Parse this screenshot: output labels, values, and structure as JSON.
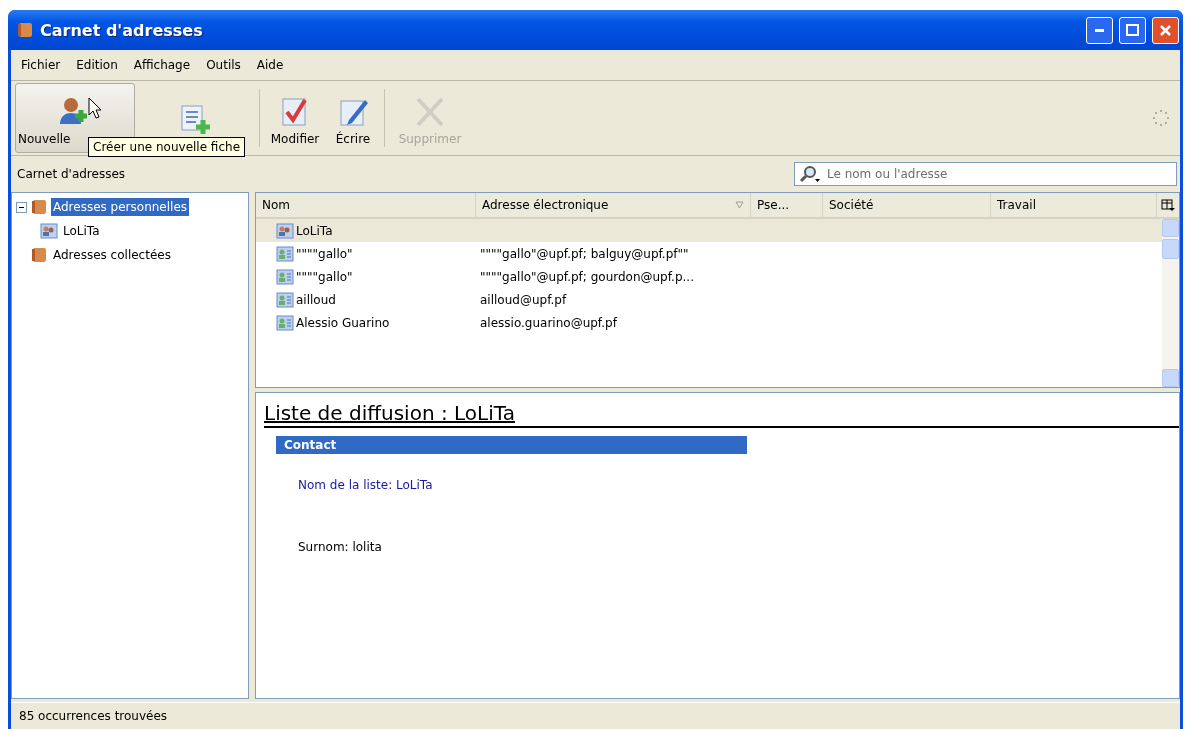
{
  "window": {
    "title": "Carnet d'adresses"
  },
  "menu": [
    "Fichier",
    "Edition",
    "Affichage",
    "Outils",
    "Aide"
  ],
  "toolbar": [
    {
      "kind": "new-card",
      "label": "Nouvelle",
      "disabled": false,
      "hovered": true
    },
    {
      "kind": "new-list",
      "disabled": false,
      "hovered": false
    },
    {
      "kind": "edit",
      "label": "Modifier",
      "disabled": false,
      "hovered": false
    },
    {
      "kind": "write",
      "label": "Écrire",
      "disabled": false,
      "hovered": false
    },
    {
      "kind": "delete",
      "label": "Supprimer",
      "disabled": true,
      "hovered": false
    }
  ],
  "tooltip": "Créer une nouvelle fiche",
  "address_bar": {
    "title": "Carnet d'adresses",
    "search": {
      "placeholder": "Le nom ou l'adresse"
    }
  },
  "sidebar": {
    "items": [
      {
        "label": "Adresses personnelles",
        "selected": true,
        "expanded": true,
        "children": [
          {
            "label": "LoLiTa",
            "selected": false
          }
        ]
      },
      {
        "label": "Adresses collectées",
        "selected": false
      }
    ]
  },
  "table": {
    "columns": [
      {
        "label": "Nom",
        "sorted": false
      },
      {
        "label": "Adresse électronique",
        "sorted": true
      },
      {
        "label": "Pse...",
        "sorted": false
      },
      {
        "label": "Société",
        "sorted": false
      },
      {
        "label": "Travail",
        "sorted": false
      }
    ],
    "rows": [
      {
        "kind": "list",
        "selected": true,
        "cells": [
          "LoLiTa",
          ""
        ]
      },
      {
        "kind": "contact",
        "selected": false,
        "cells": [
          "\"\"\"\"gallo\"",
          "\"\"\"\"gallo\"@upf.pf; balguy@upf.pf\"\""
        ]
      },
      {
        "kind": "contact",
        "selected": false,
        "cells": [
          "\"\"\"\"gallo\"",
          "\"\"\"\"gallo\"@upf.pf; gourdon@upf.p..."
        ]
      },
      {
        "kind": "contact",
        "selected": false,
        "cells": [
          "ailloud",
          "ailloud@upf.pf"
        ]
      },
      {
        "kind": "contact",
        "selected": false,
        "cells": [
          "Alessio Guarino",
          "alessio.guarino@upf.pf"
        ]
      }
    ]
  },
  "detail": {
    "title": "Liste de diffusion : LoLiTa",
    "section": "Contact",
    "list_name": "Nom de la liste: LoLiTa",
    "nickname": "Surnom: lolita"
  },
  "status_bar": "85 occurrences trouvées"
}
